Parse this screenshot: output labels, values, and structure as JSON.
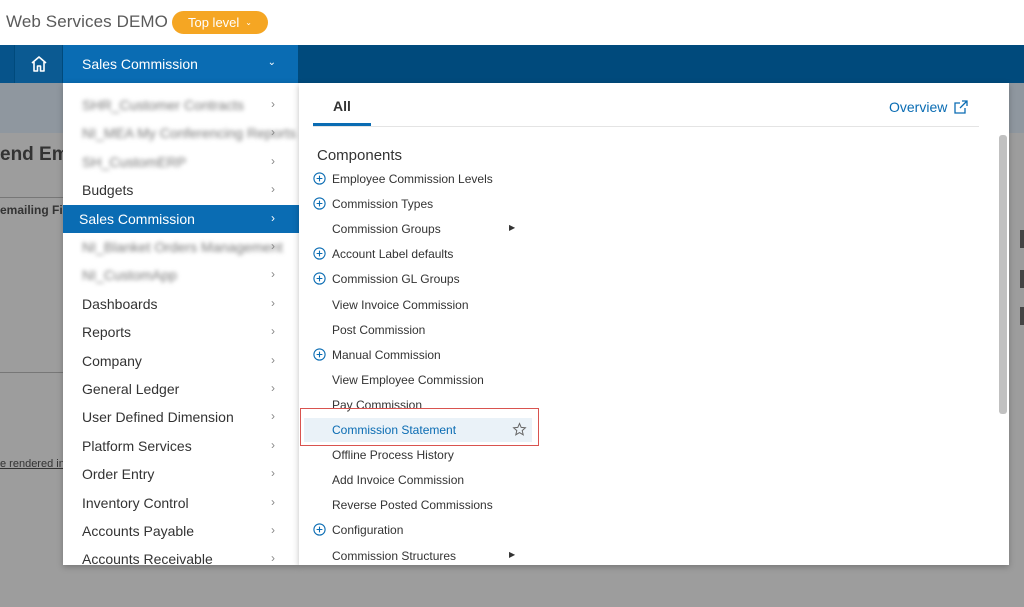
{
  "app": {
    "title": "Web Services DEMO",
    "level_label": "Top level"
  },
  "nav": {
    "module_label": "Sales Commission"
  },
  "background": {
    "heading": "end Em",
    "filter_text": "emailing Fil",
    "rendered_text": "e rendered in"
  },
  "menu": {
    "items": [
      {
        "label": "SHR_Customer Contracts",
        "blurred": true
      },
      {
        "label": "NI_MEA My Conferencing Reports",
        "blurred": true
      },
      {
        "label": "SH_CustomERP",
        "blurred": true
      },
      {
        "label": "Budgets",
        "blurred": false
      },
      {
        "label": "Sales Commission",
        "blurred": false,
        "active": true
      },
      {
        "label": "NI_Blanket Orders Management",
        "blurred": true
      },
      {
        "label": "NI_CustomApp",
        "blurred": true
      },
      {
        "label": "Dashboards",
        "blurred": false
      },
      {
        "label": "Reports",
        "blurred": false
      },
      {
        "label": "Company",
        "blurred": false
      },
      {
        "label": "General Ledger",
        "blurred": false
      },
      {
        "label": "User Defined Dimension",
        "blurred": false
      },
      {
        "label": "Platform Services",
        "blurred": false
      },
      {
        "label": "Order Entry",
        "blurred": false
      },
      {
        "label": "Inventory Control",
        "blurred": false
      },
      {
        "label": "Accounts Payable",
        "blurred": false
      },
      {
        "label": "Accounts Receivable",
        "blurred": false
      }
    ]
  },
  "panel": {
    "tab_all": "All",
    "overview_label": "Overview",
    "section_title": "Components",
    "components": [
      {
        "label": "Employee Commission Levels",
        "plus": true
      },
      {
        "label": "Commission Types",
        "plus": true
      },
      {
        "label": "Commission Groups",
        "plus": false,
        "submenu": true
      },
      {
        "label": "Account Label defaults",
        "plus": true
      },
      {
        "label": "Commission GL Groups",
        "plus": true
      },
      {
        "label": "View Invoice Commission",
        "plus": false
      },
      {
        "label": "Post Commission",
        "plus": false
      },
      {
        "label": "Manual Commission",
        "plus": true
      },
      {
        "label": "View Employee Commission",
        "plus": false
      },
      {
        "label": "Pay Commission",
        "plus": false
      },
      {
        "label": "Commission Statement",
        "plus": false,
        "highlighted": true
      },
      {
        "label": "Offline Process History",
        "plus": false
      },
      {
        "label": "Add Invoice Commission",
        "plus": false
      },
      {
        "label": "Reverse Posted Commissions",
        "plus": false
      },
      {
        "label": "Configuration",
        "plus": true
      },
      {
        "label": "Commission Structures",
        "plus": false,
        "submenu": true
      }
    ]
  },
  "colors": {
    "accent": "#0a6cb3",
    "nav_dark": "#004a7c",
    "level_badge": "#f5a623",
    "highlight_border": "#d9534f"
  }
}
